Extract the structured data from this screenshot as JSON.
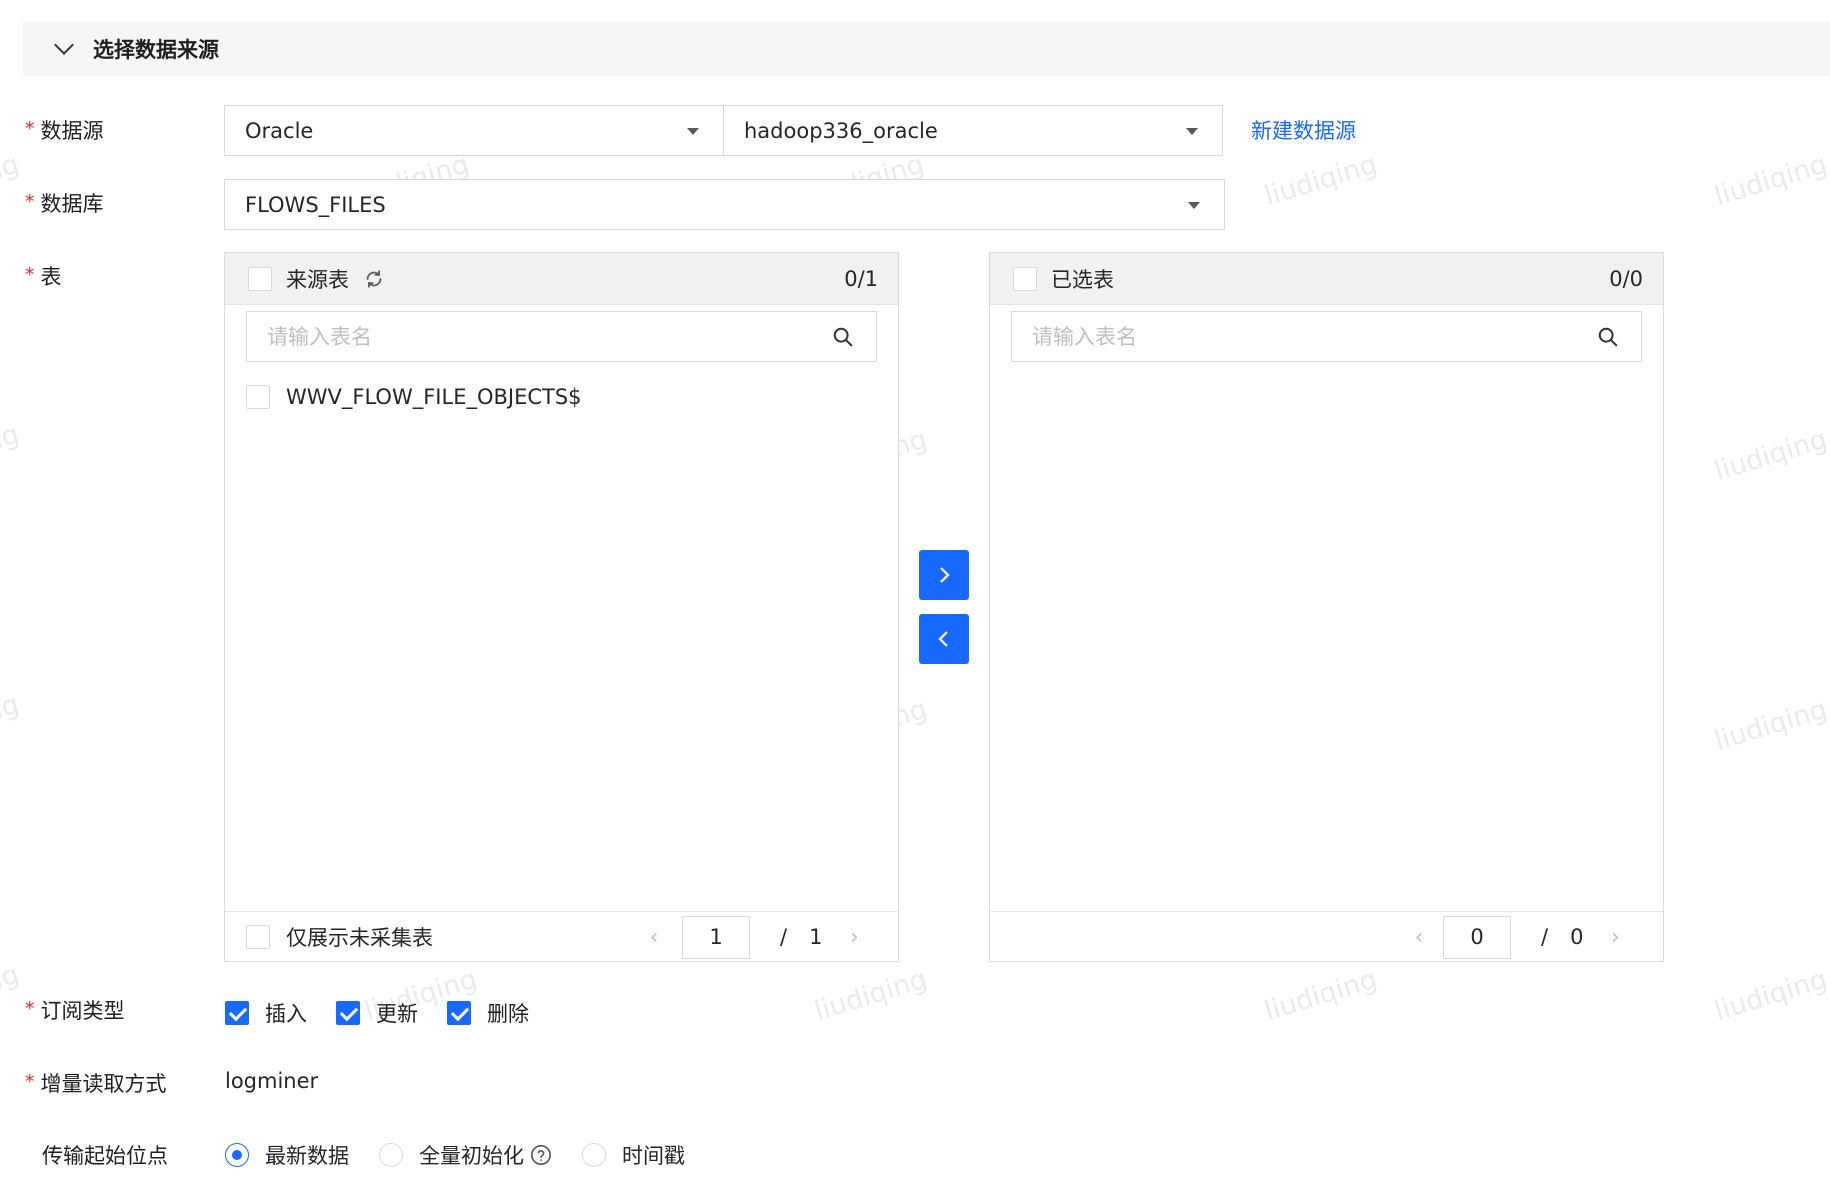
{
  "watermark": "liudiqing",
  "section": {
    "title": "选择数据来源"
  },
  "form": {
    "datasource": {
      "label": "数据源",
      "type_value": "Oracle",
      "instance_value": "hadoop336_oracle",
      "new_link": "新建数据源"
    },
    "database": {
      "label": "数据库",
      "value": "FLOWS_FILES"
    },
    "table": {
      "label": "表"
    },
    "subscribe": {
      "label": "订阅类型",
      "options": [
        {
          "label": "插入",
          "checked": true
        },
        {
          "label": "更新",
          "checked": true
        },
        {
          "label": "删除",
          "checked": true
        }
      ]
    },
    "incremental": {
      "label": "增量读取方式",
      "value": "logminer"
    },
    "start_point": {
      "label": "传输起始位点",
      "options": [
        {
          "label": "最新数据",
          "selected": true
        },
        {
          "label": "全量初始化",
          "selected": false,
          "help": true
        },
        {
          "label": "时间戳",
          "selected": false
        }
      ]
    }
  },
  "source_panel": {
    "title": "来源表",
    "count": "0/1",
    "search_placeholder": "请输入表名",
    "items": [
      "WWV_FLOW_FILE_OBJECTS$"
    ],
    "footer_checkbox": "仅展示未采集表",
    "page_current": "1",
    "page_sep": "/",
    "page_total": "1"
  },
  "target_panel": {
    "title": "已选表",
    "count": "0/0",
    "search_placeholder": "请输入表名",
    "page_current": "0",
    "page_sep": "/",
    "page_total": "0"
  },
  "colors": {
    "primary": "#1769ff",
    "required": "#f5222d",
    "header_bg": "#f5f6f7"
  }
}
